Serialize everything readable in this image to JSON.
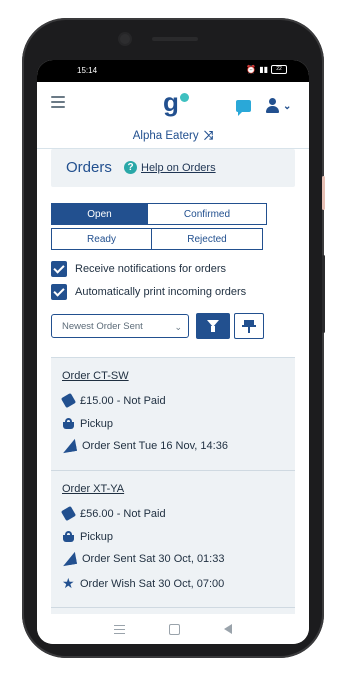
{
  "status": {
    "time": "15:14",
    "battery": "22"
  },
  "header": {
    "logo": "g",
    "restaurant": "Alpha Eatery"
  },
  "page": {
    "title": "Orders",
    "help_link": "Help on Orders",
    "help_icon": "?"
  },
  "tabs": [
    "Open",
    "Confirmed",
    "Ready",
    "Rejected"
  ],
  "options": {
    "notifications_label": "Receive notifications for orders",
    "autoprint_label": "Automatically print incoming orders"
  },
  "sort": {
    "selected": "Newest Order Sent"
  },
  "orders": [
    {
      "id": "Order CT-SW",
      "payment": "£15.00 - Not Paid",
      "method": "Pickup",
      "sent": "Order Sent Tue 16 Nov, 14:36"
    },
    {
      "id": "Order XT-YA",
      "payment": "£56.00 - Not Paid",
      "method": "Pickup",
      "sent": "Order Sent Sat 30 Oct, 01:33",
      "wish": "Order Wish Sat 30 Oct, 07:00"
    }
  ],
  "colors": {
    "brand": "#22508f",
    "accent": "#3fc0c0",
    "panel": "#eef2f5"
  }
}
